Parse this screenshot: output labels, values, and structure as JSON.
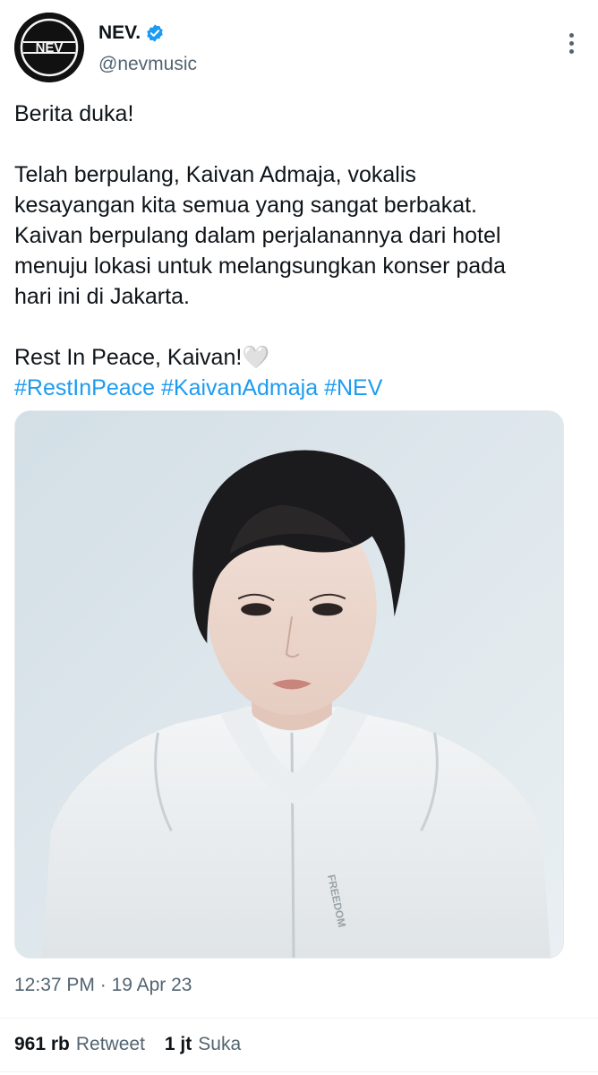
{
  "author": {
    "display_name": "NEV.",
    "handle": "@nevmusic",
    "verified": true,
    "avatar_logo_text": "NEV"
  },
  "tweet": {
    "lines": [
      "Berita duka!",
      "",
      "Telah berpulang, Kaivan Admaja, vokalis",
      "kesayangan kita semua yang sangat berbakat.",
      "Kaivan berpulang dalam perjalanannya dari hotel",
      "menuju lokasi untuk melangsungkan konser pada",
      "hari ini di Jakarta.",
      "",
      "Rest In Peace, Kaivan!🤍"
    ],
    "hashtags": [
      "#RestInPeace",
      "#KaivanAdmaja",
      "#NEV"
    ],
    "media": {
      "shirt_text": "FREEDOM"
    }
  },
  "meta": {
    "time": "12:37 PM",
    "separator": "·",
    "date": "19 Apr 23"
  },
  "stats": {
    "retweets_count": "961 rb",
    "retweets_label": "Retweet",
    "likes_count": "1 jt",
    "likes_label": "Suka"
  },
  "colors": {
    "accent": "#1d9bf0",
    "secondary_text": "#536471",
    "primary_text": "#0f1419"
  }
}
